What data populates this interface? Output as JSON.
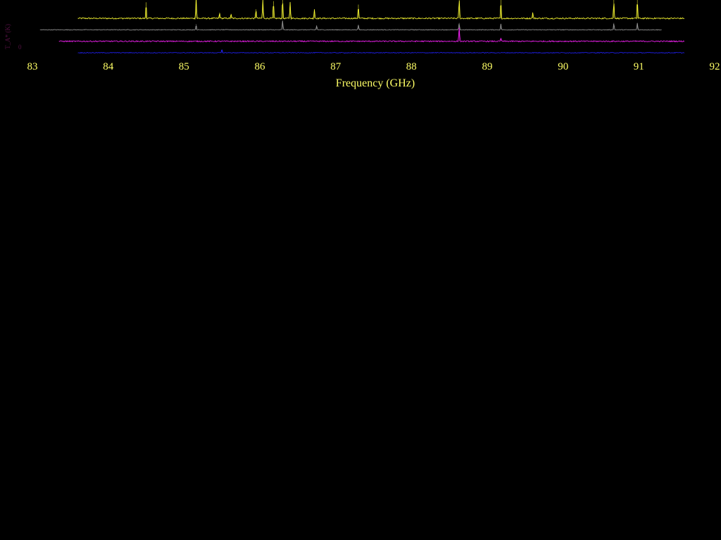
{
  "chart_data": {
    "type": "line",
    "xlabel": "Frequency (GHz)",
    "ylabel": "T_A* (K)",
    "y_tick_label": "0",
    "xlim": [
      83,
      92
    ],
    "x_ticks": [
      "83",
      "84",
      "85",
      "86",
      "87",
      "88",
      "89",
      "90",
      "91",
      "92"
    ],
    "colors": {
      "background": "#000000",
      "axis_text": "#ffff66",
      "ylabel_text": "#551144"
    },
    "series": [
      {
        "color": "#ffff33",
        "x_range": [
          83.6,
          91.6
        ],
        "baseline": 3.0,
        "noise": 0.06,
        "lines": [
          {
            "x": 84.5,
            "h": 1.4
          },
          {
            "x": 85.16,
            "h": 1.8
          },
          {
            "x": 85.47,
            "h": 0.5
          },
          {
            "x": 85.62,
            "h": 0.4
          },
          {
            "x": 85.95,
            "h": 0.8
          },
          {
            "x": 86.04,
            "h": 1.6
          },
          {
            "x": 86.18,
            "h": 1.5
          },
          {
            "x": 86.3,
            "h": 1.8
          },
          {
            "x": 86.4,
            "h": 1.4
          },
          {
            "x": 86.72,
            "h": 0.8
          },
          {
            "x": 87.3,
            "h": 1.2
          },
          {
            "x": 88.63,
            "h": 1.8
          },
          {
            "x": 89.18,
            "h": 1.6
          },
          {
            "x": 89.6,
            "h": 0.5
          },
          {
            "x": 90.67,
            "h": 1.6
          },
          {
            "x": 90.98,
            "h": 1.8
          }
        ]
      },
      {
        "color": "#9a9a9a",
        "x_range": [
          83.1,
          91.3
        ],
        "baseline": 2.0,
        "noise": 0.03,
        "lines": [
          {
            "x": 85.16,
            "h": 0.5
          },
          {
            "x": 86.3,
            "h": 0.8
          },
          {
            "x": 86.75,
            "h": 0.4
          },
          {
            "x": 87.3,
            "h": 0.4
          },
          {
            "x": 88.63,
            "h": 0.6
          },
          {
            "x": 89.18,
            "h": 0.5
          },
          {
            "x": 90.67,
            "h": 0.6
          },
          {
            "x": 90.98,
            "h": 0.6
          }
        ]
      },
      {
        "color": "#ff22ff",
        "x_range": [
          83.35,
          91.6
        ],
        "baseline": 1.0,
        "noise": 0.05,
        "lines": [
          {
            "x": 88.63,
            "h": 1.2
          },
          {
            "x": 89.18,
            "h": 0.3
          }
        ]
      },
      {
        "color": "#2222ff",
        "x_range": [
          83.6,
          91.6
        ],
        "baseline": 0.0,
        "noise": 0.03,
        "lines": [
          {
            "x": 85.5,
            "h": 0.3
          }
        ]
      }
    ]
  }
}
